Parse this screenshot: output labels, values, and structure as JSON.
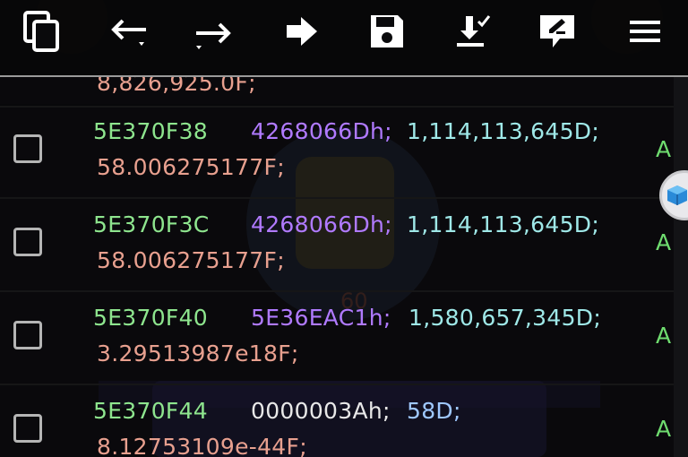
{
  "toolbar": {
    "icons": [
      "copy-icon",
      "arrow-left-icon",
      "arrow-right-icon",
      "arrow-goto-icon",
      "save-icon",
      "download-icon",
      "edit-note-icon",
      "menu-icon"
    ]
  },
  "colors": {
    "address": "#8ee58e",
    "hex_purple": "#b07aff",
    "hex_white": "#e8e8e8",
    "decimal": "#9fe8e8",
    "float": "#e8a08f",
    "flag": "#6fdc6f"
  },
  "list": {
    "partial_row_text": "8,826,925.0F;",
    "rows": [
      {
        "address": "5E370F38",
        "hex": "4268066Dh;",
        "decimal": "1,114,113,645D;",
        "float": "58.006275177F;",
        "flag": "A"
      },
      {
        "address": "5E370F3C",
        "hex": "4268066Dh;",
        "decimal": "1,114,113,645D;",
        "float": "58.006275177F;",
        "flag": "A"
      },
      {
        "address": "5E370F40",
        "hex": "5E36EAC1h;",
        "decimal": "1,580,657,345D;",
        "float": "3.29513987e18F;",
        "flag": "A"
      },
      {
        "address": "5E370F44",
        "hex": "0000003Ah;",
        "decimal": "58D;",
        "float": "8.12753109e-44F;",
        "flag": "A"
      }
    ]
  },
  "background": {
    "badge_number": "60"
  },
  "floating_button": {
    "icon": "cube-icon"
  }
}
